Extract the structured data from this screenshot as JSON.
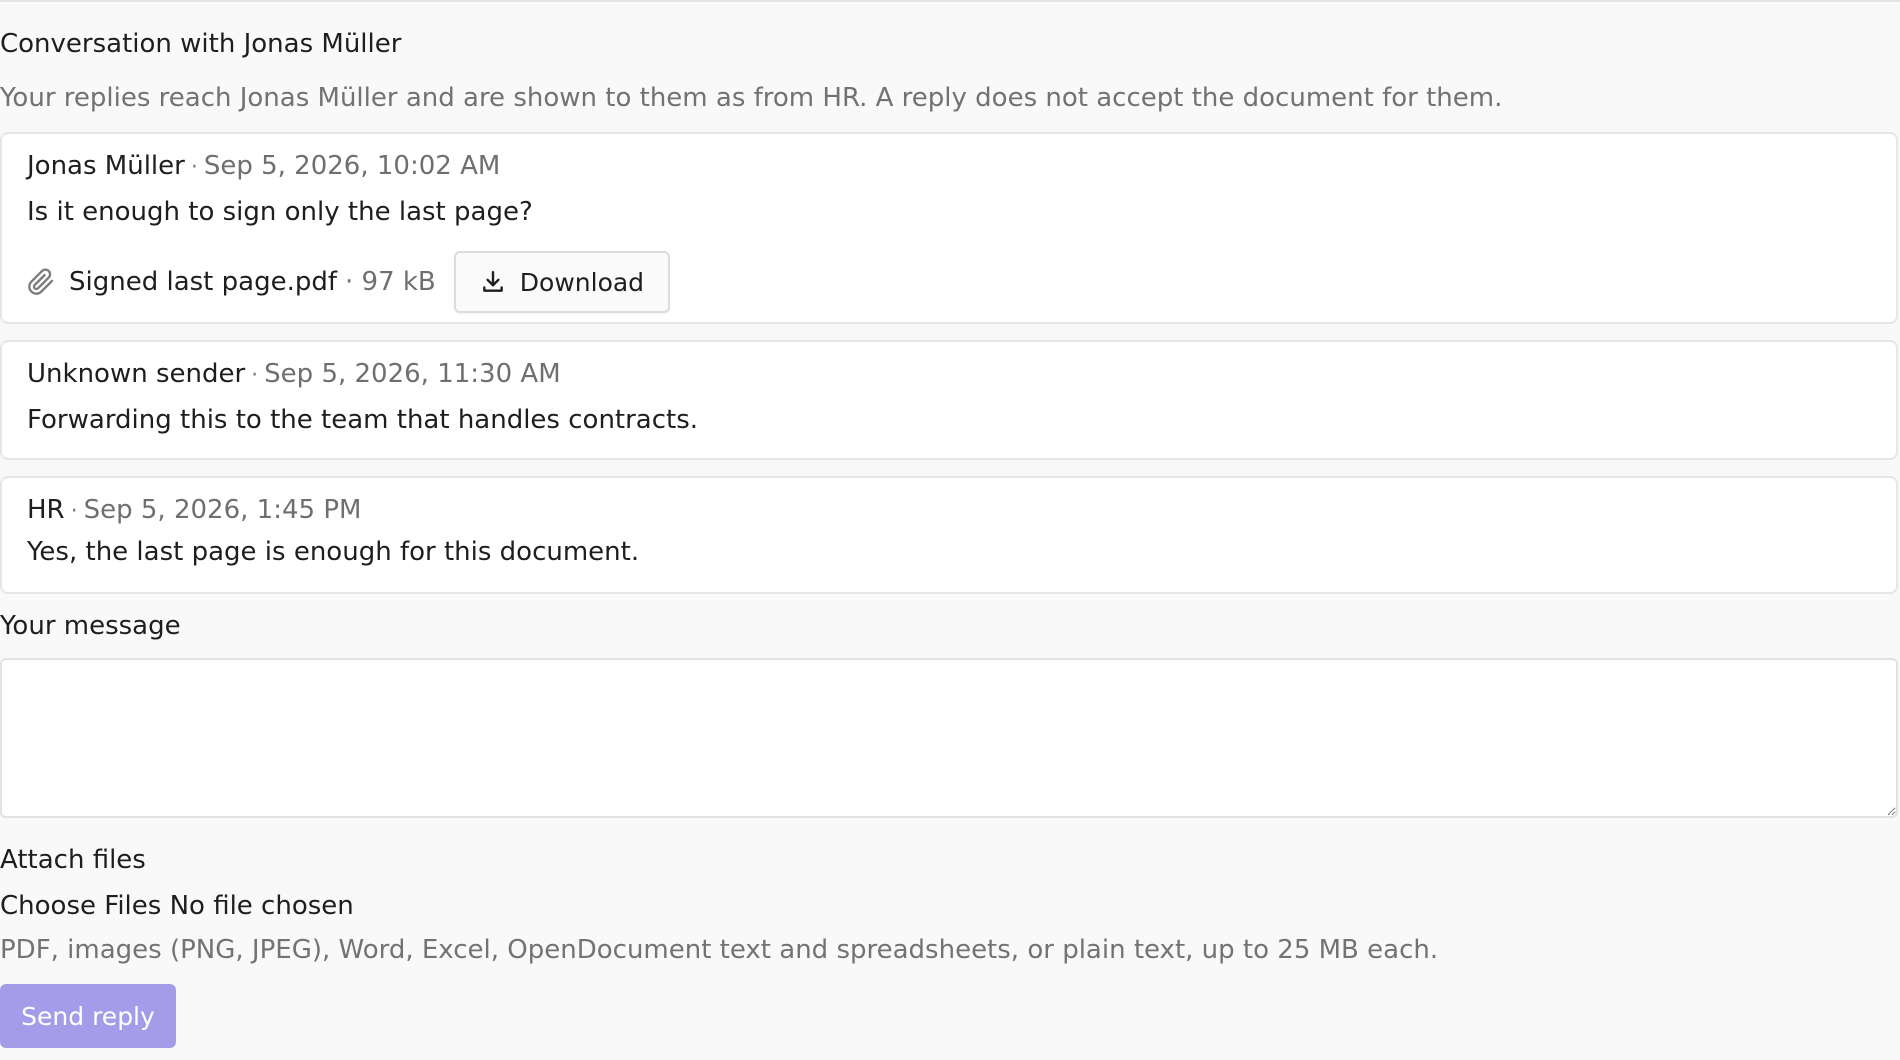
{
  "conversation": {
    "title": "Conversation with Jonas Müller",
    "hint": "Your replies reach Jonas Müller and are shown to them as from HR. A reply does not accept the document for them."
  },
  "messages": [
    {
      "sender": "Jonas Müller",
      "separator": "·",
      "date": "Sep 5, 2026, 10:02 AM",
      "body": "Is it enough to sign only the last page?",
      "attachment": {
        "icon": "paperclip-icon",
        "filename": "Signed last page.pdf",
        "size": "· 97 kB",
        "download_label": "Download"
      }
    },
    {
      "sender": "Unknown sender",
      "separator": "·",
      "date": "Sep 5, 2026, 11:30 AM",
      "body": "Forwarding this to the team that handles contracts."
    },
    {
      "sender": "HR",
      "separator": "·",
      "date": "Sep 5, 2026, 1:45 PM",
      "body": "Yes, the last page is enough for this document."
    }
  ],
  "reply": {
    "message_label": "Your message",
    "message_value": "",
    "attach_label": "Attach files",
    "choose_files_label": "Choose Files",
    "no_file_text": "No file chosen",
    "help_text": "PDF, images (PNG, JPEG), Word, Excel, OpenDocument text and spreadsheets, or plain text, up to 25 MB each.",
    "send_label": "Send reply"
  },
  "colors": {
    "send_button": "#a49ce8",
    "muted_text": "#727272",
    "background": "#f9f9f9"
  }
}
